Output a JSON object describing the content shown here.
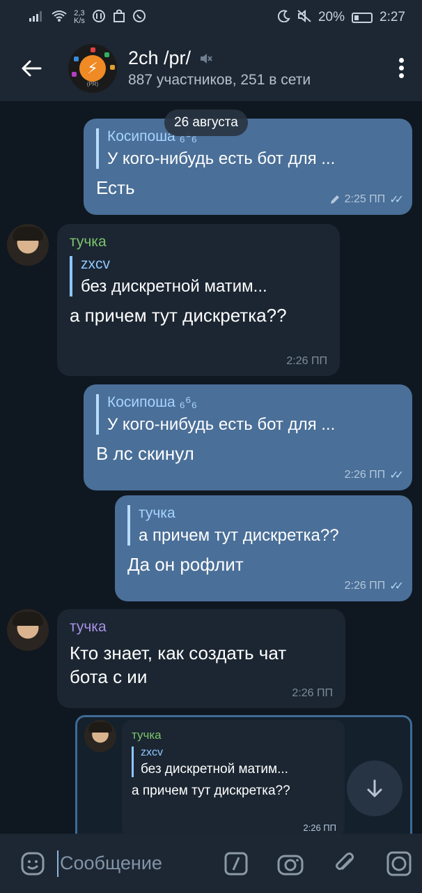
{
  "status_bar": {
    "net_speed_value": "2,3",
    "net_speed_unit": "K/s",
    "battery": "20%",
    "time": "2:27"
  },
  "header": {
    "title": "2ch /pr/",
    "subtitle": "887 участников, 251 в сети",
    "avatar_tag": "(PR)"
  },
  "date_pill": "26 августа",
  "messages": [
    {
      "direction": "out",
      "reply_name": "Косипоша ₆⁶₆",
      "reply_text": "У кого-нибудь есть бот для ...",
      "text": "Есть",
      "time": "2:25 ПП",
      "edited": true
    },
    {
      "direction": "in",
      "sender": "тучка",
      "reply_name": "zxcv",
      "reply_text": "без дискретной матим...",
      "text": "а причем тут дискретка??",
      "time": "2:26 ПП"
    },
    {
      "direction": "out",
      "reply_name": "Косипоша ₆⁶₆",
      "reply_text": "У кого-нибудь есть бот для ...",
      "text": "В лс скинул",
      "time": "2:26 ПП"
    },
    {
      "direction": "out",
      "reply_name": "тучка",
      "reply_text": "а причем тут дискретка??",
      "text": "Да он рофлит",
      "time": "2:26 ПП"
    },
    {
      "direction": "in",
      "sender": "тучка",
      "text_line1": "Кто знает, как создать чат",
      "text_line2": "бота с ии",
      "time": "2:26 ПП"
    }
  ],
  "highlighted_message": {
    "sender": "тучка",
    "reply_name": "zxcv",
    "reply_text": "без дискретной матим...",
    "text": "а причем тут дискретка??",
    "time": "2:26 ПП"
  },
  "input": {
    "placeholder": "Сообщение"
  },
  "icons": {
    "back": "arrow-left-icon",
    "mute": "muted-speaker-icon",
    "menu": "more-vert-icon",
    "emoji": "sticker-emoji-icon",
    "commands": "slash-command-icon",
    "camera": "camera-icon",
    "attach": "paperclip-icon",
    "instant_camera": "round-camera-icon",
    "scroll_down": "chevron-down-icon"
  },
  "colors": {
    "outgoing_bubble": "#4a6f98",
    "incoming_bubble": "#1b2632",
    "header_bg": "#1d2733",
    "chat_bg": "#0f1720",
    "sender_green": "#7cc36b",
    "sender_purple": "#a891e6"
  }
}
